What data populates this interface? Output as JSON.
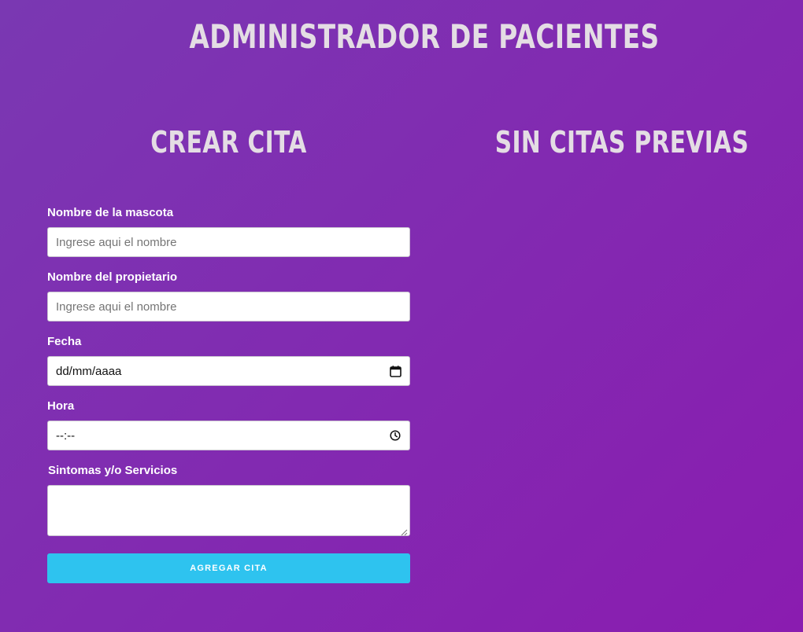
{
  "header": {
    "title": "ADMINISTRADOR DE PACIENTES"
  },
  "form": {
    "title": "CREAR CITA",
    "fields": [
      {
        "label": "Nombre de la mascota",
        "placeholder": "Ingrese aqui el nombre"
      },
      {
        "label": "Nombre del propietario",
        "placeholder": "Ingrese aqui el nombre"
      },
      {
        "label": "Fecha",
        "value": "dd/mm/aaaa",
        "icon": "calendar-icon"
      },
      {
        "label": "Hora",
        "value": "--:--",
        "icon": "clock-icon"
      },
      {
        "label": "Sintomas y/o Servicios"
      }
    ],
    "submit_label": "AGREGAR CITA"
  },
  "list": {
    "title": "SIN CITAS PREVIAS"
  },
  "colors": {
    "background_start": "#7a38b2",
    "background_end": "#8a1cb0",
    "heading": "#e4dde4",
    "button": "#2ec3ef"
  }
}
